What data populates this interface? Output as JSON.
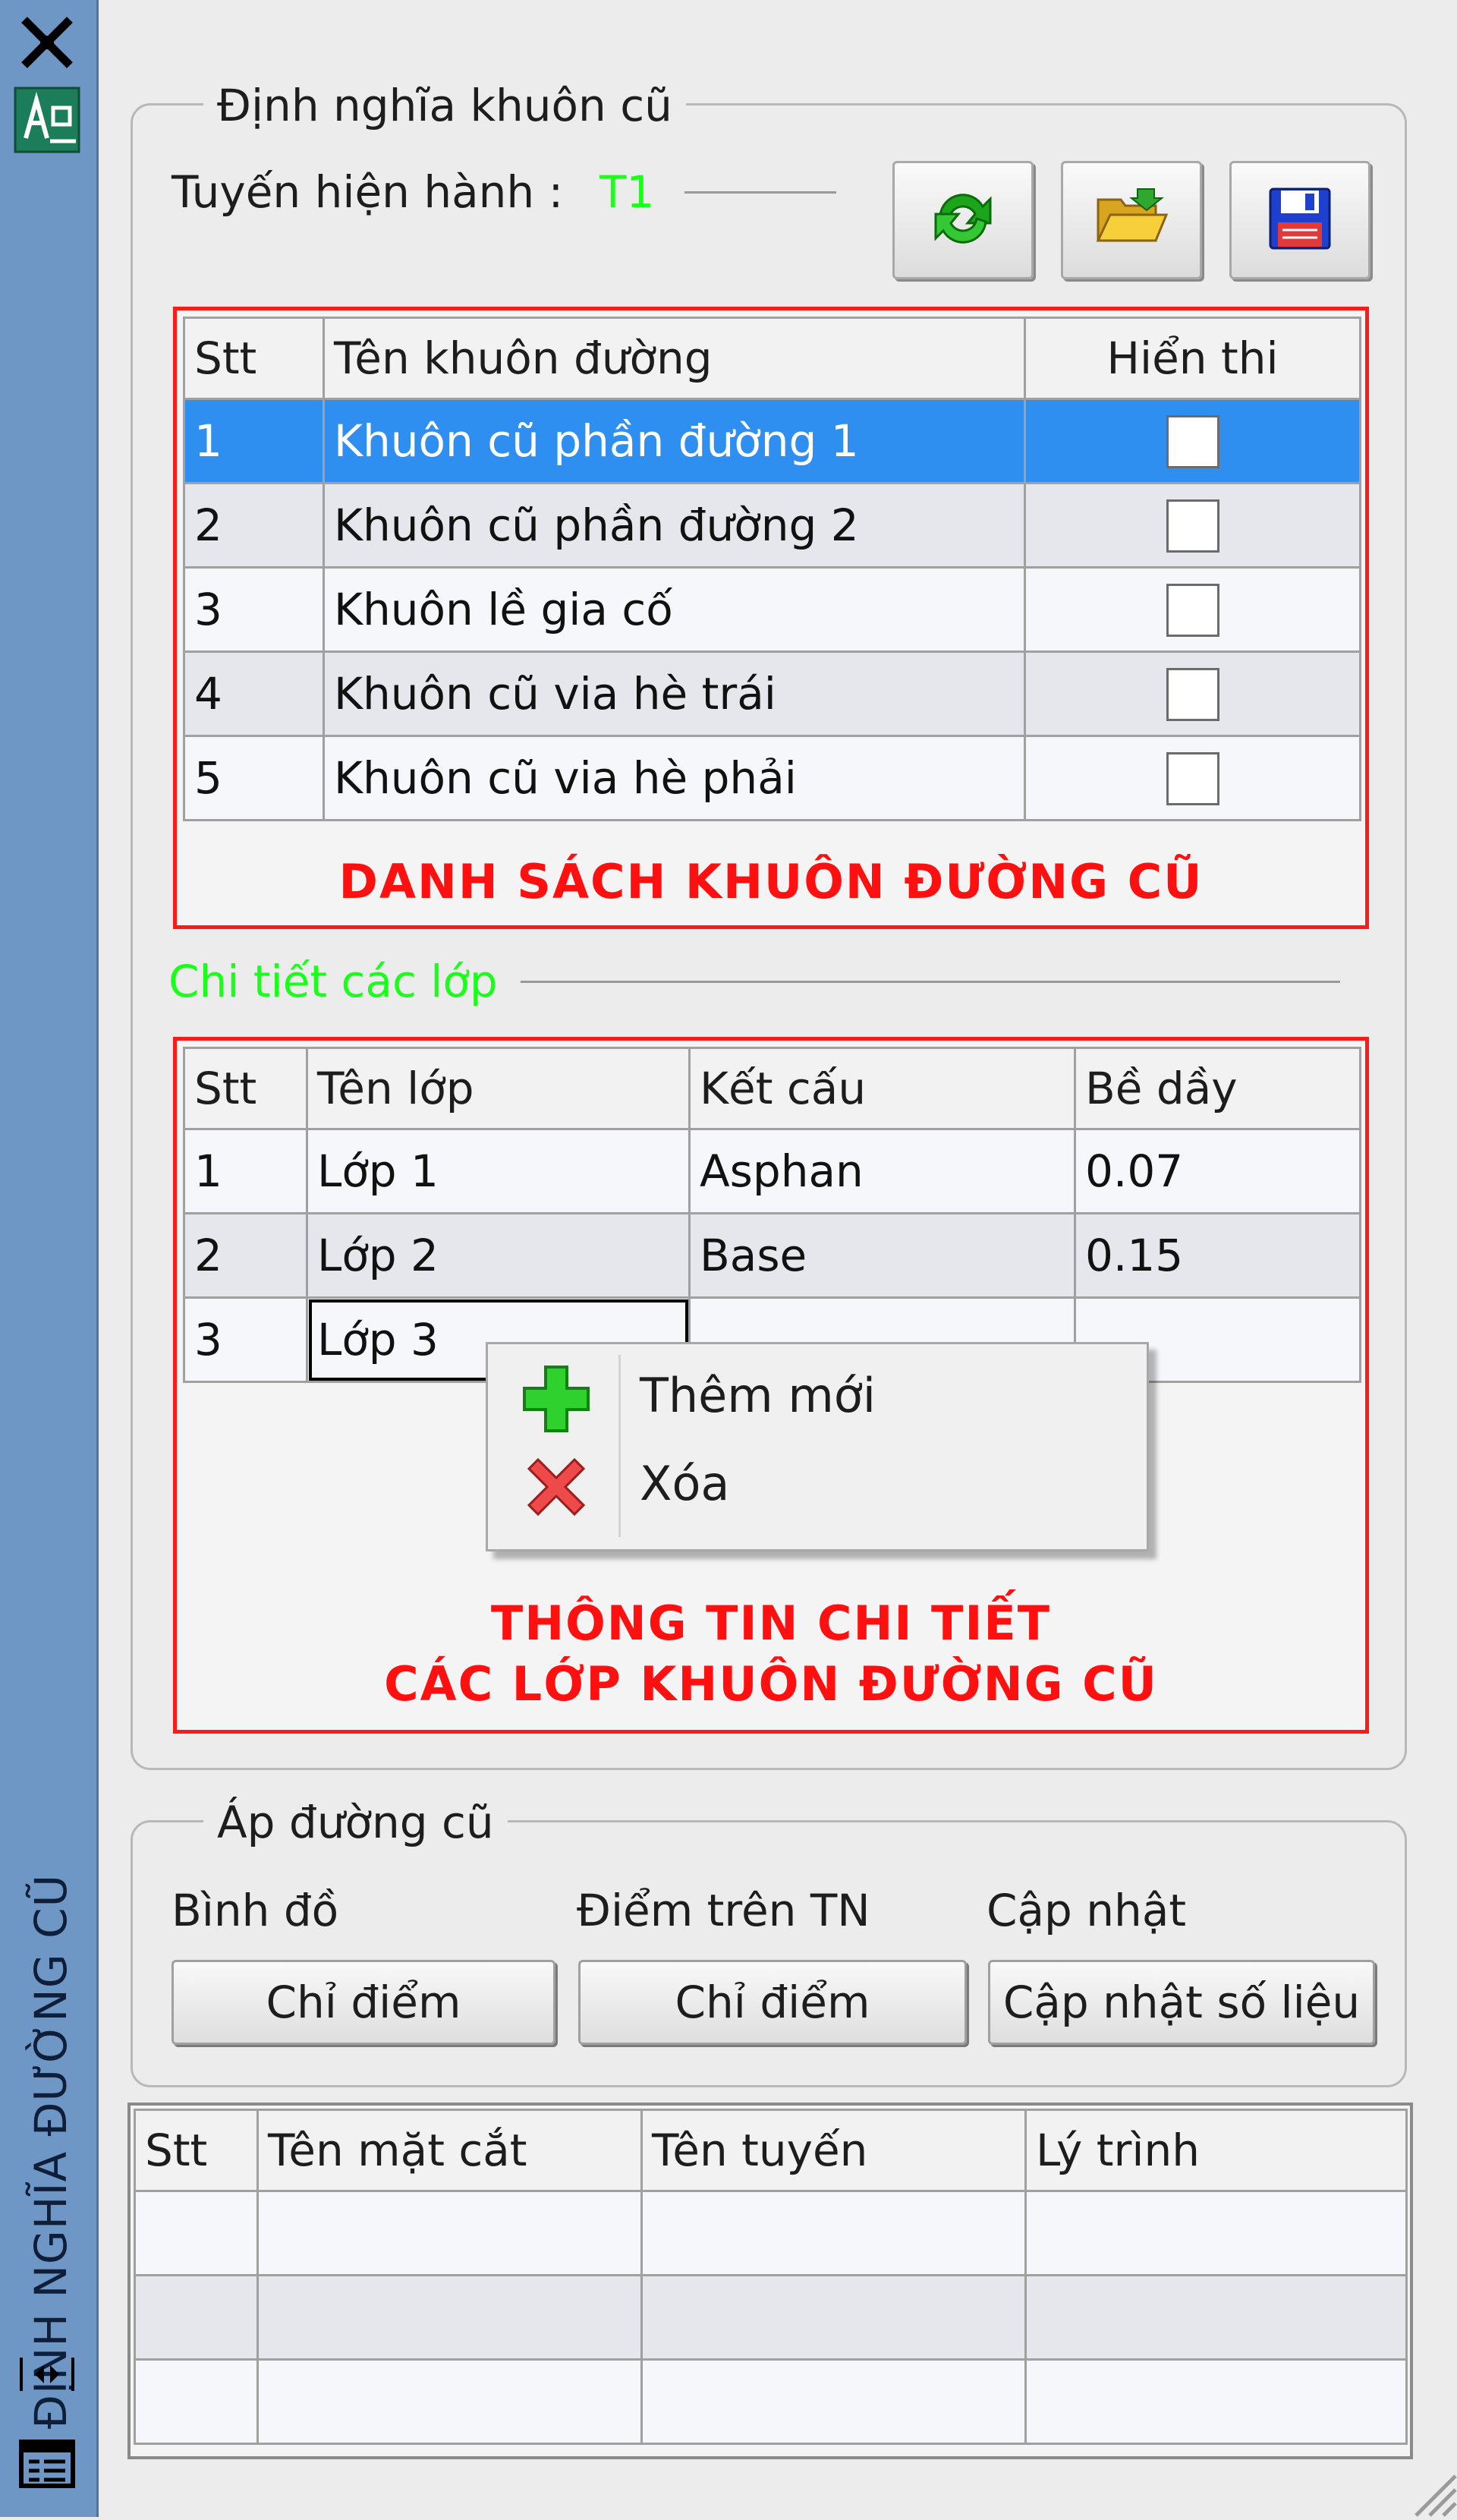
{
  "sidebar": {
    "title": "ĐỊNH NGHĨA ĐƯỜNG CŨ",
    "icons": [
      "close-icon",
      "app-icon",
      "expand-icon",
      "properties-icon"
    ]
  },
  "old_template": {
    "group_title": "Định nghĩa khuôn cũ",
    "route_label": "Tuyến hiện hành :",
    "route_value": "T1",
    "toolbar": {
      "refresh_icon": "refresh-icon",
      "open_icon": "open-folder-icon",
      "save_icon": "save-icon"
    },
    "template_grid": {
      "headers": [
        "Stt",
        "Tên khuôn đường",
        "Hiển thi"
      ],
      "rows": [
        {
          "stt": "1",
          "name": "Khuôn cũ phần đường 1",
          "shown": false,
          "selected": true
        },
        {
          "stt": "2",
          "name": "Khuôn cũ phần đường 2",
          "shown": false,
          "selected": false
        },
        {
          "stt": "3",
          "name": "Khuôn lề gia cố",
          "shown": false,
          "selected": false
        },
        {
          "stt": "4",
          "name": "Khuôn cũ via hè trái",
          "shown": false,
          "selected": false
        },
        {
          "stt": "5",
          "name": "Khuôn cũ via hè phải",
          "shown": false,
          "selected": false
        }
      ],
      "caption": "DANH SÁCH KHUÔN ĐƯỜNG CŨ"
    },
    "layers_title": "Chi tiết các lớp",
    "layer_grid": {
      "headers": [
        "Stt",
        "Tên lớp",
        "Kết cấu",
        "Bề dầy"
      ],
      "rows": [
        {
          "stt": "1",
          "name": "Lớp 1",
          "structure": "Asphan",
          "thickness": "0.07"
        },
        {
          "stt": "2",
          "name": "Lớp 2",
          "structure": "Base",
          "thickness": "0.15"
        },
        {
          "stt": "3",
          "name": "Lớp 3",
          "structure": "",
          "thickness": ""
        }
      ],
      "caption_line1": "THÔNG TIN CHI TIẾT",
      "caption_line2": "CÁC LỚP KHUÔN ĐƯỜNG CŨ"
    }
  },
  "context_menu": {
    "items": [
      {
        "label": "Thêm mới",
        "icon": "add-icon"
      },
      {
        "label": "Xóa",
        "icon": "delete-icon"
      }
    ]
  },
  "apply": {
    "group_title": "Áp đường cũ",
    "col1_label": "Bình đồ",
    "col2_label": "Điểm trên TN",
    "col3_label": "Cập nhật",
    "btn1": "Chỉ điểm",
    "btn2": "Chỉ điểm",
    "btn3": "Cập nhật số liệu"
  },
  "section_grid": {
    "headers": [
      "Stt",
      "Tên mặt cắt",
      "Tên tuyến",
      "Lý trình"
    ],
    "empty_rows": 3
  },
  "colors": {
    "sidebar": "#6f97c6",
    "highlight_frame": "#ff1a1a",
    "selection": "#2f8ff0",
    "green_text": "#19ff19"
  }
}
